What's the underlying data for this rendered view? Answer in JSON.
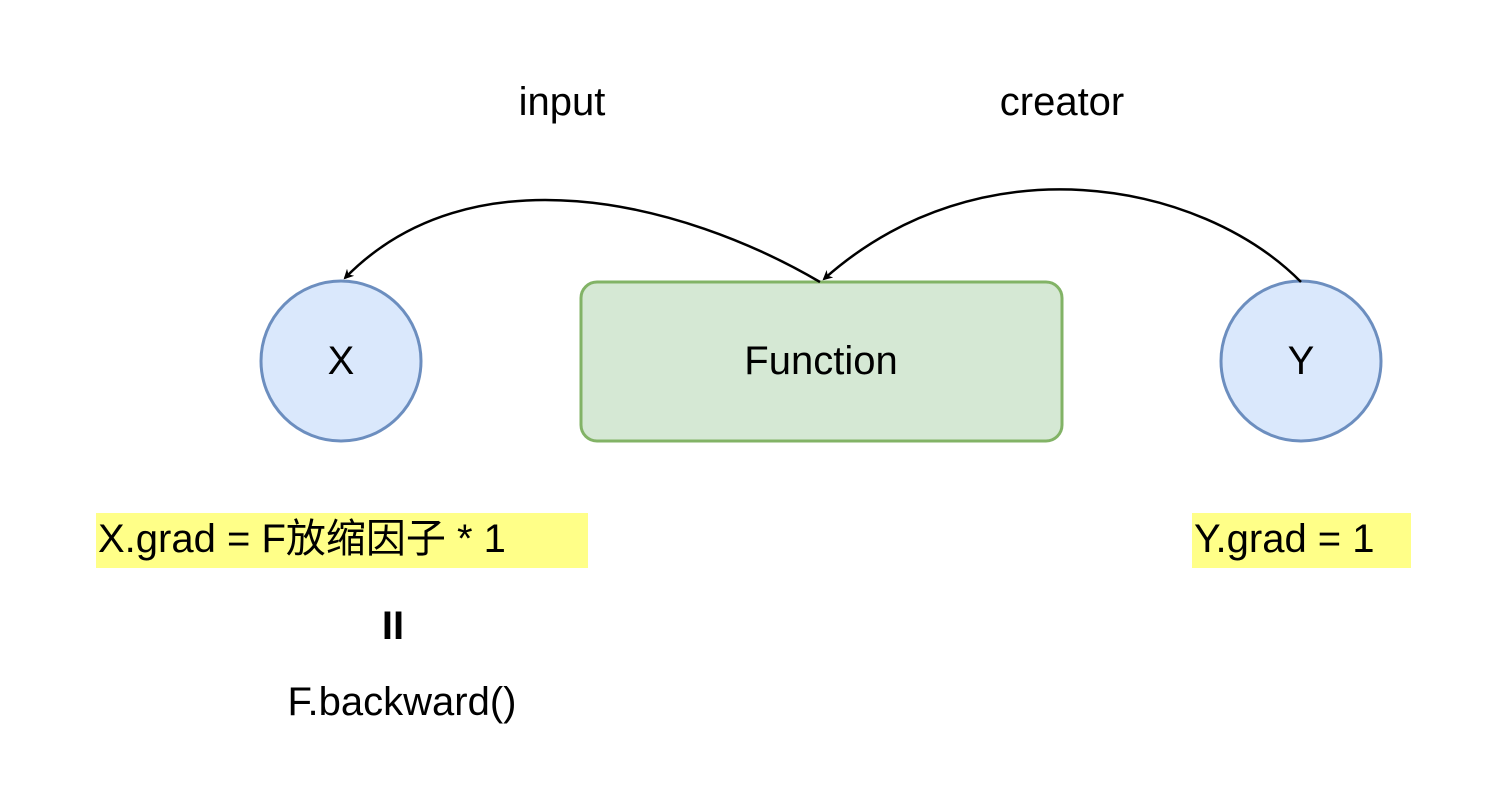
{
  "nodes": {
    "x": {
      "label": "X",
      "fill": "#dae8fc",
      "stroke": "#6c8ebf"
    },
    "function": {
      "label": "Function",
      "fill": "#d5e8d4",
      "stroke": "#82b366"
    },
    "y": {
      "label": "Y",
      "fill": "#dae8fc",
      "stroke": "#6c8ebf"
    }
  },
  "edges": {
    "input": {
      "label": "input"
    },
    "creator": {
      "label": "creator"
    }
  },
  "annotations": {
    "x_grad": "X.grad = F放缩因子 * 1",
    "equals_rotated": "II",
    "backward": "F.backward()",
    "y_grad": "Y.grad = 1",
    "highlight_color": "#ffff88"
  }
}
